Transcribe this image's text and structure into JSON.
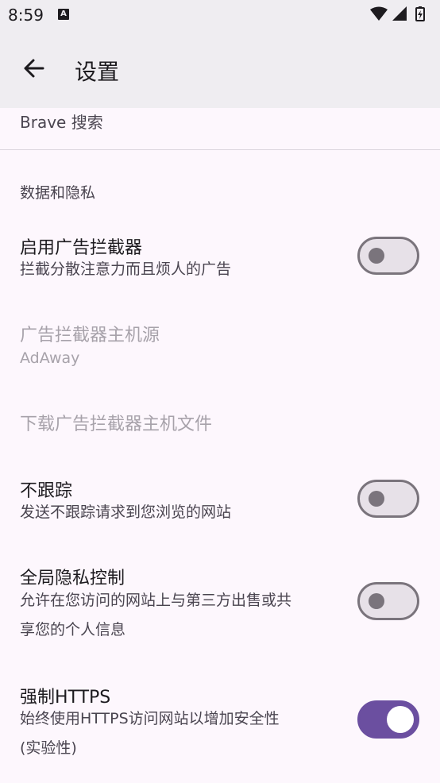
{
  "status_bar": {
    "time": "8:59",
    "notification_letter": "A"
  },
  "app_bar": {
    "title": "设置"
  },
  "settings": {
    "search_engine_value": "Brave 搜索",
    "section_privacy": "数据和隐私",
    "ad_blocker": {
      "title": "启用广告拦截器",
      "subtitle": "拦截分散注意力而且烦人的广告",
      "enabled": false
    },
    "ad_blocker_hosts": {
      "title": "广告拦截器主机源",
      "subtitle": "AdAway"
    },
    "download_hosts": {
      "title": "下载广告拦截器主机文件"
    },
    "do_not_track": {
      "title": "不跟踪",
      "subtitle": "发送不跟踪请求到您浏览的网站",
      "enabled": false
    },
    "global_privacy_control": {
      "title": "全局隐私控制",
      "subtitle_line1": "允许在您访问的网站上与第三方出售或共",
      "subtitle_line2": "享您的个人信息",
      "enabled": false
    },
    "force_https": {
      "title": "强制HTTPS",
      "subtitle_line1": "始终使用HTTPS访问网站以增加安全性",
      "subtitle_line2": "(实验性)",
      "enabled": true
    }
  },
  "colors": {
    "accent": "#6b4fa0",
    "background": "#fdf7fd",
    "app_bar": "#efedf1"
  }
}
